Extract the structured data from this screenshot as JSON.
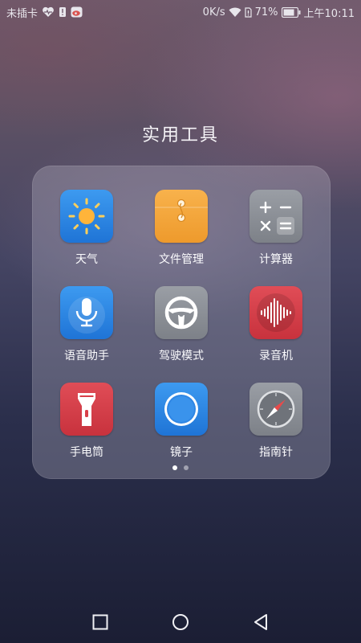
{
  "status_bar": {
    "carrier": "未插卡",
    "net_speed": "0K/s",
    "battery": "71%",
    "time": "上午10:11",
    "icons": [
      "heart-monitor-icon",
      "sim-alert-icon",
      "weibo-icon",
      "wifi-icon",
      "sim-card-icon",
      "battery-icon"
    ]
  },
  "folder": {
    "title": "实用工具",
    "apps": [
      {
        "label": "天气",
        "icon": "weather-sun-icon",
        "color": "#2b86e6"
      },
      {
        "label": "文件管理",
        "icon": "folder-icon",
        "color": "#f3a33a"
      },
      {
        "label": "计算器",
        "icon": "calculator-icon",
        "color": "#8a8e95"
      },
      {
        "label": "语音助手",
        "icon": "microphone-icon",
        "color": "#2b86e6"
      },
      {
        "label": "驾驶模式",
        "icon": "steering-wheel-icon",
        "color": "#8a8e95"
      },
      {
        "label": "录音机",
        "icon": "sound-wave-icon",
        "color": "#d8404a"
      },
      {
        "label": "手电筒",
        "icon": "flashlight-icon",
        "color": "#d8404a"
      },
      {
        "label": "镜子",
        "icon": "mirror-icon",
        "color": "#2b86e6"
      },
      {
        "label": "指南针",
        "icon": "compass-icon",
        "color": "#8a8e95"
      }
    ],
    "page_count": 2,
    "current_page": 1
  },
  "nav_bar": {
    "buttons": [
      "recent-apps-icon",
      "home-icon",
      "back-icon"
    ]
  }
}
